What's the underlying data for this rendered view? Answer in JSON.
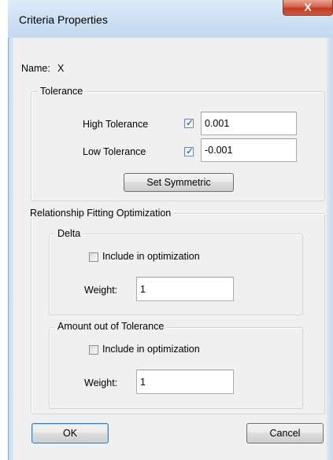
{
  "window": {
    "title": "Criteria Properties",
    "close_glyph": "X"
  },
  "name_row": {
    "label": "Name:",
    "value": "X"
  },
  "tolerance": {
    "legend": "Tolerance",
    "high_label": "High Tolerance",
    "high_checked": true,
    "high_value": "0.001",
    "low_label": "Low Tolerance",
    "low_checked": true,
    "low_value": "-0.001",
    "set_symmetric": "Set Symmetric"
  },
  "optimization": {
    "legend": "Relationship Fitting Optimization",
    "delta": {
      "legend": "Delta",
      "include_label": "Include in optimization",
      "include_checked": false,
      "weight_label": "Weight:",
      "weight_value": "1"
    },
    "amount": {
      "legend": "Amount out of Tolerance",
      "include_label": "Include in optimization",
      "include_checked": false,
      "weight_label": "Weight:",
      "weight_value": "1"
    }
  },
  "buttons": {
    "ok": "OK",
    "cancel": "Cancel"
  }
}
